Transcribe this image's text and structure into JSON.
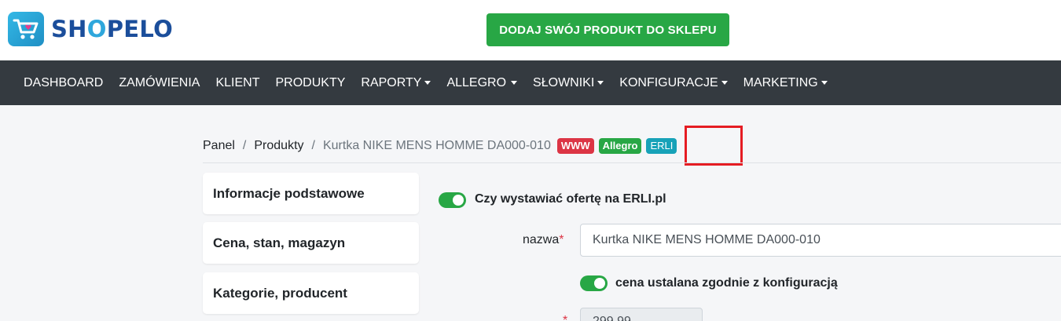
{
  "brand": {
    "name_part1": "SH",
    "name_o": "O",
    "name_part2": "PELO"
  },
  "cta": {
    "label": "DODAJ SWÓJ PRODUKT DO SKLEPU"
  },
  "nav": {
    "items": [
      {
        "label": "DASHBOARD",
        "dropdown": false
      },
      {
        "label": "ZAMÓWIENIA",
        "dropdown": false
      },
      {
        "label": "KLIENT",
        "dropdown": false
      },
      {
        "label": "PRODUKTY",
        "dropdown": false
      },
      {
        "label": "RAPORTY",
        "dropdown": true
      },
      {
        "label": "ALLEGRO",
        "dropdown": true
      },
      {
        "label": "SŁOWNIKI",
        "dropdown": true
      },
      {
        "label": "KONFIGURACJE",
        "dropdown": true
      },
      {
        "label": "MARKETING",
        "dropdown": true
      }
    ]
  },
  "breadcrumb": {
    "panel": "Panel",
    "sep": "/",
    "products": "Produkty",
    "current": "Kurtka NIKE MENS HOMME DA000-010",
    "badges": {
      "www": "WWW",
      "allegro": "Allegro",
      "erli": "ERLI"
    }
  },
  "sidebar": {
    "sections": [
      "Informacje podstawowe",
      "Cena, stan, magazyn",
      "Kategorie, producent"
    ]
  },
  "form": {
    "erli_toggle": {
      "label": "Czy wystawiać ofertę na ERLI.pl",
      "checked": true
    },
    "name_field": {
      "label": "nazwa",
      "required_mark": "*",
      "value": "Kurtka NIKE MENS HOMME DA000-010"
    },
    "price_toggle": {
      "label": "cena ustalana zgodnie z konfiguracją",
      "checked": true
    },
    "price_field": {
      "required_mark": "*",
      "value": "299,99"
    }
  },
  "colors": {
    "nav_bg": "#343a40",
    "cta_green": "#28a745",
    "badge_www": "#dc3545",
    "badge_allegro": "#28a745",
    "badge_erli": "#17a2b8",
    "highlight_red": "#e51c23"
  }
}
